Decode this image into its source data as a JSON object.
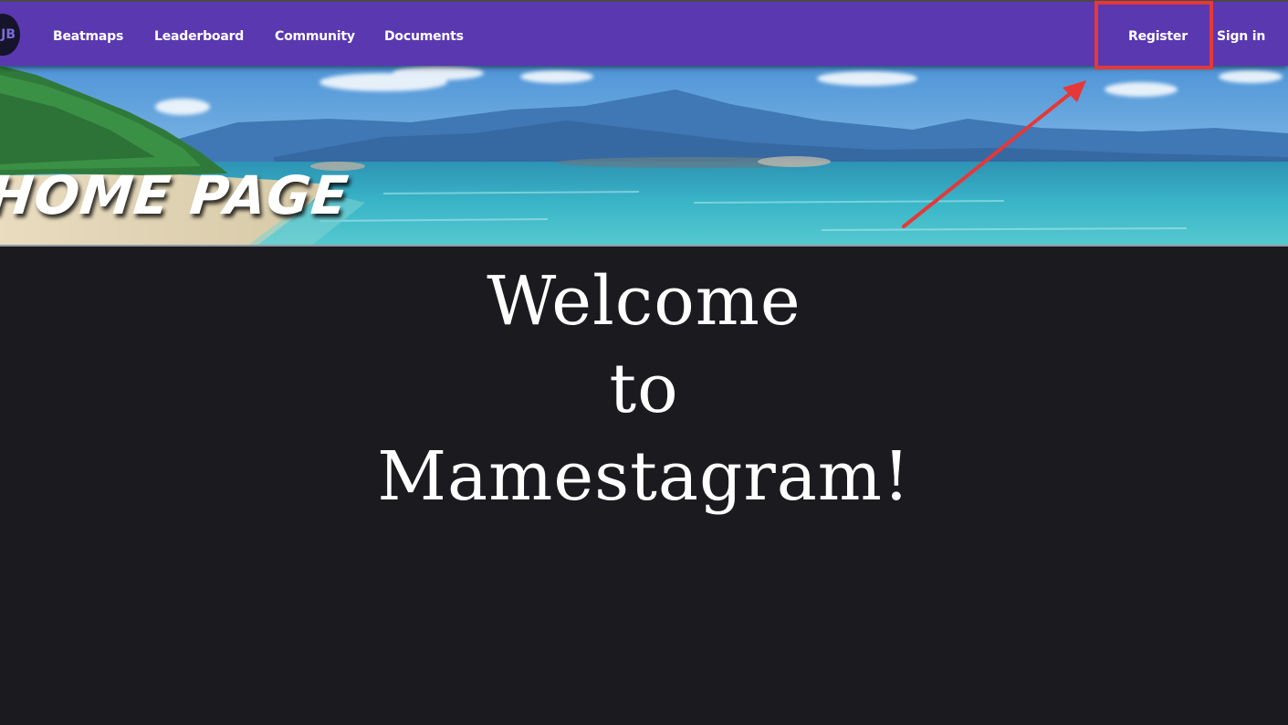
{
  "navbar": {
    "logo_text": "JB",
    "links": [
      {
        "label": "Beatmaps"
      },
      {
        "label": "Leaderboard"
      },
      {
        "label": "Community"
      },
      {
        "label": "Documents"
      }
    ],
    "register_label": "Register",
    "signin_label": "Sign in",
    "background_color": "#5a38b0"
  },
  "hero": {
    "title": "HOME PAGE"
  },
  "welcome": {
    "line1": "Welcome",
    "line2": "to",
    "line3": "Mamestagram!"
  },
  "annotation": {
    "highlight_color": "#e53838"
  }
}
